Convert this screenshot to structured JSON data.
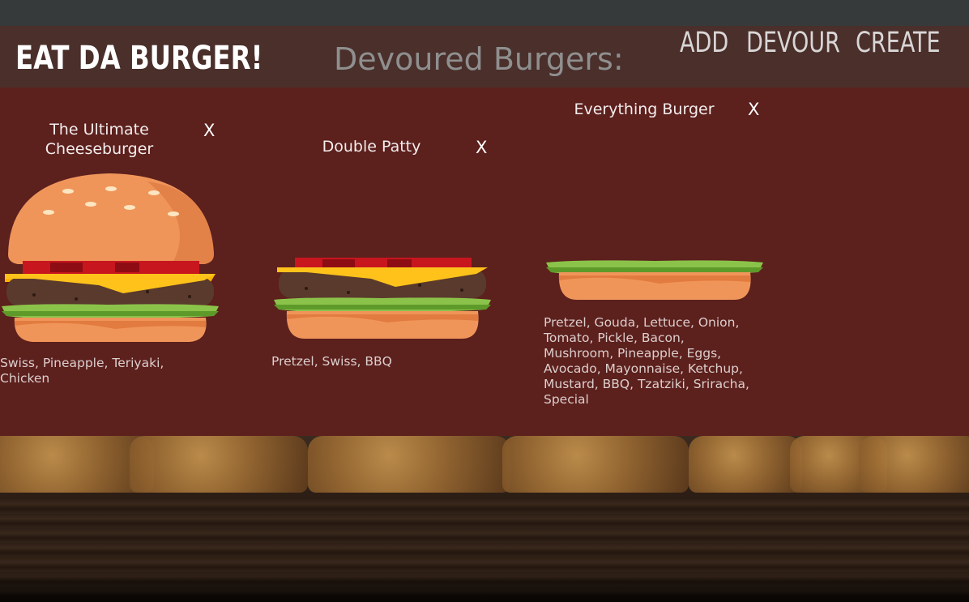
{
  "header": {
    "brand": "EAT DA BURGER!",
    "nav": {
      "add": "ADD",
      "devour": "DEVOUR",
      "create": "CREATE"
    }
  },
  "main": {
    "section_title": "Devoured Burgers:",
    "burgers": [
      {
        "name": "The Ultimate Cheeseburger",
        "remove_label": "X",
        "toppings": "Swiss, Pineapple, Teriyaki, Chicken"
      },
      {
        "name": "Double Patty",
        "remove_label": "X",
        "toppings": "Pretzel, Swiss, BBQ"
      },
      {
        "name": "Everything Burger",
        "remove_label": "X",
        "toppings": "Pretzel, Gouda, Lettuce, Onion, Tomato, Pickle, Bacon, Mushroom, Pineapple, Eggs, Avocado, Mayonnaise, Ketchup, Mustard, BBQ, Tzatziki, Sriracha, Special"
      }
    ]
  },
  "colors": {
    "navbar": "#4a2f2b",
    "panel": "#5c201d",
    "bun": "#f0955a",
    "cheese": "#ffc21a",
    "lettuce": "#8bc34a",
    "patty": "#5a3a2c"
  },
  "icons": {
    "burger_image": "burger-illustration"
  }
}
